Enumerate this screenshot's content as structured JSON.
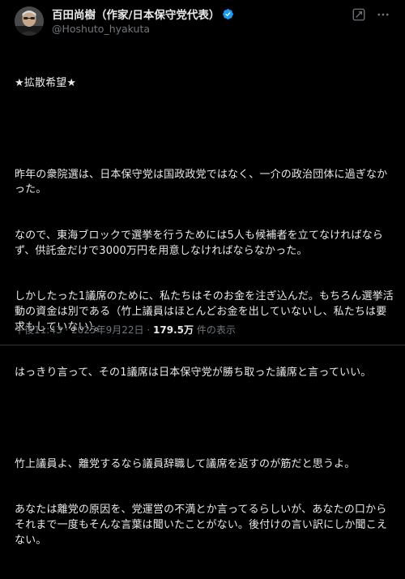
{
  "post": {
    "author": {
      "display_name": "百田尚樹（作家/日本保守党代表）",
      "handle": "@Hoshuto_hyakuta",
      "verified_icon": "verified-badge-icon"
    },
    "icons": {
      "grok": "grok-icon",
      "more": "more-options-icon"
    },
    "text": {
      "line1": "★拡散希望★",
      "para1": "昨年の衆院選は、日本保守党は国政政党ではなく、一介の政治団体に過ぎなかった。",
      "para2": "なので、東海ブロックで選挙を行うためには5人も候補者を立てなければならず、供託金だけで3000万円を用意しなければならなかった。",
      "para3": "しかしたった1議席のために、私たちはそのお金を注ぎ込んだ。もちろん選挙活動の資金は別である（竹上議員はほとんどお金を出していないし、私たちは要求もしていない）。",
      "para4": "はっきり言って、その1議席は日本保守党が勝ち取った議席と言っていい。",
      "para5": "竹上議員よ、離党するなら議員辞職して議席を返すのが筋だと思うよ。",
      "para6": "あなたは離党の原因を、党運営の不満とか言ってるらしいが、あなたの口からそれまで一度もそんな言葉は聞いたことがない。後付けの言い訳にしか聞こえない。"
    },
    "meta": {
      "time": "午後11:43",
      "separator": "·",
      "date": "2025年9月22日",
      "views_count": "179.5万",
      "views_label": "件の表示"
    }
  },
  "colors": {
    "background": "#000000",
    "text": "#e7e9ea",
    "secondary": "#71767b",
    "verified": "#1d9bf0"
  }
}
